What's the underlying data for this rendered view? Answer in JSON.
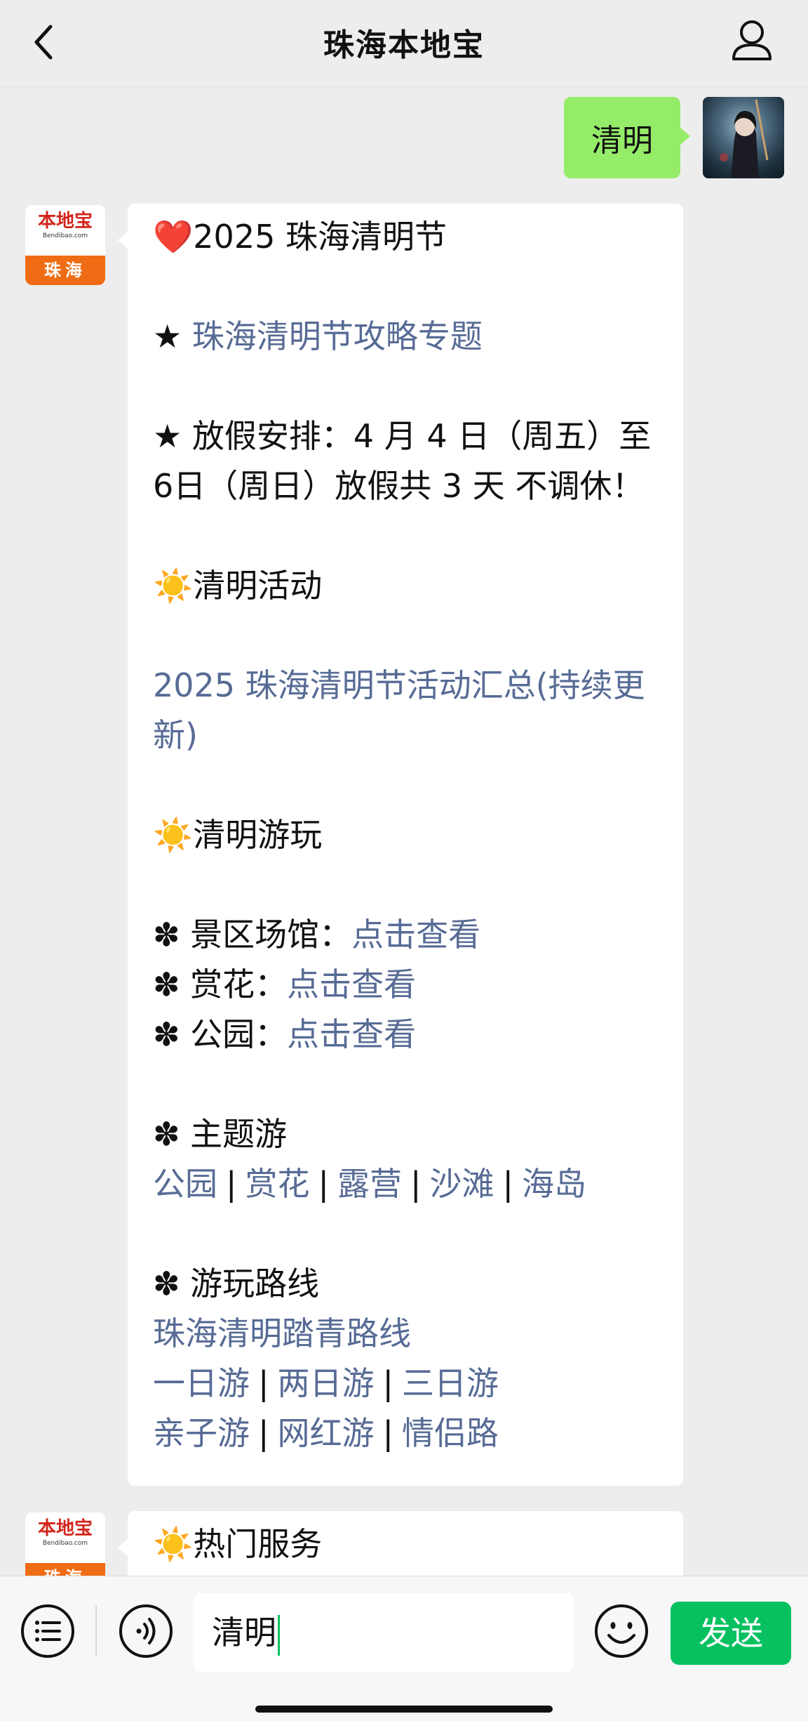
{
  "header": {
    "title": "珠海本地宝",
    "back_icon": "chevron-left-icon",
    "profile_icon": "person-icon"
  },
  "outgoing": {
    "text": "清明"
  },
  "bot": {
    "avatar_brand": "本地宝",
    "avatar_url": "Bendibao.com",
    "avatar_city": "珠海"
  },
  "message1": {
    "title_emoji": "❤️",
    "title": "2025 珠海清明节",
    "star": "★",
    "topic_link": "珠海清明节攻略专题",
    "holiday_line1": "★ 放假安排：4 月 4 日（周五）至",
    "holiday_line2": "6日（周日）放假共 3 天 不调休！",
    "sun": "☀️",
    "activity_heading": "清明活动",
    "activity_link": "2025 珠海清明节活动汇总(持续更新)",
    "play_heading": "清明游玩",
    "clover": "✽",
    "venues_label": "景区场馆：",
    "flowers_label": "赏花：",
    "park_label": "公园：",
    "view_link": "点击查看",
    "theme_heading": "主题游",
    "theme_links": [
      "公园",
      "赏花",
      "露营",
      "沙滩",
      "海岛"
    ],
    "route_heading": "游玩路线",
    "route_link": "珠海清明踏青路线",
    "route_links_row1": [
      "一日游",
      "两日游",
      "三日游"
    ],
    "route_links_row2": [
      "亲子游",
      "网红游",
      "情侣路"
    ],
    "separator": "|"
  },
  "message2": {
    "heading": "热门服务"
  },
  "inputbar": {
    "menu_icon": "menu-list-icon",
    "voice_icon": "voice-icon",
    "input_value": "清明",
    "emoji_icon": "emoji-icon",
    "send_label": "发送"
  },
  "colors": {
    "link": "#576b95",
    "send_green": "#07c160",
    "bubble_green": "#95ec69",
    "background": "#ededed"
  }
}
